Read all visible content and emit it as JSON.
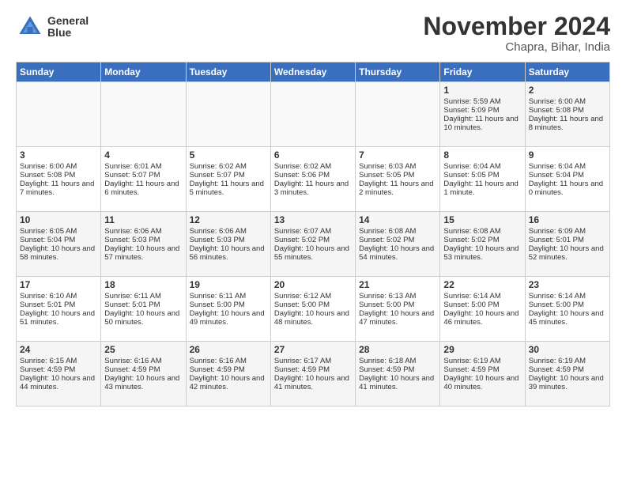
{
  "header": {
    "logo_line1": "General",
    "logo_line2": "Blue",
    "month": "November 2024",
    "location": "Chapra, Bihar, India"
  },
  "weekdays": [
    "Sunday",
    "Monday",
    "Tuesday",
    "Wednesday",
    "Thursday",
    "Friday",
    "Saturday"
  ],
  "weeks": [
    [
      {
        "day": "",
        "info": ""
      },
      {
        "day": "",
        "info": ""
      },
      {
        "day": "",
        "info": ""
      },
      {
        "day": "",
        "info": ""
      },
      {
        "day": "",
        "info": ""
      },
      {
        "day": "1",
        "info": "Sunrise: 5:59 AM\nSunset: 5:09 PM\nDaylight: 11 hours and 10 minutes."
      },
      {
        "day": "2",
        "info": "Sunrise: 6:00 AM\nSunset: 5:08 PM\nDaylight: 11 hours and 8 minutes."
      }
    ],
    [
      {
        "day": "3",
        "info": "Sunrise: 6:00 AM\nSunset: 5:08 PM\nDaylight: 11 hours and 7 minutes."
      },
      {
        "day": "4",
        "info": "Sunrise: 6:01 AM\nSunset: 5:07 PM\nDaylight: 11 hours and 6 minutes."
      },
      {
        "day": "5",
        "info": "Sunrise: 6:02 AM\nSunset: 5:07 PM\nDaylight: 11 hours and 5 minutes."
      },
      {
        "day": "6",
        "info": "Sunrise: 6:02 AM\nSunset: 5:06 PM\nDaylight: 11 hours and 3 minutes."
      },
      {
        "day": "7",
        "info": "Sunrise: 6:03 AM\nSunset: 5:05 PM\nDaylight: 11 hours and 2 minutes."
      },
      {
        "day": "8",
        "info": "Sunrise: 6:04 AM\nSunset: 5:05 PM\nDaylight: 11 hours and 1 minute."
      },
      {
        "day": "9",
        "info": "Sunrise: 6:04 AM\nSunset: 5:04 PM\nDaylight: 11 hours and 0 minutes."
      }
    ],
    [
      {
        "day": "10",
        "info": "Sunrise: 6:05 AM\nSunset: 5:04 PM\nDaylight: 10 hours and 58 minutes."
      },
      {
        "day": "11",
        "info": "Sunrise: 6:06 AM\nSunset: 5:03 PM\nDaylight: 10 hours and 57 minutes."
      },
      {
        "day": "12",
        "info": "Sunrise: 6:06 AM\nSunset: 5:03 PM\nDaylight: 10 hours and 56 minutes."
      },
      {
        "day": "13",
        "info": "Sunrise: 6:07 AM\nSunset: 5:02 PM\nDaylight: 10 hours and 55 minutes."
      },
      {
        "day": "14",
        "info": "Sunrise: 6:08 AM\nSunset: 5:02 PM\nDaylight: 10 hours and 54 minutes."
      },
      {
        "day": "15",
        "info": "Sunrise: 6:08 AM\nSunset: 5:02 PM\nDaylight: 10 hours and 53 minutes."
      },
      {
        "day": "16",
        "info": "Sunrise: 6:09 AM\nSunset: 5:01 PM\nDaylight: 10 hours and 52 minutes."
      }
    ],
    [
      {
        "day": "17",
        "info": "Sunrise: 6:10 AM\nSunset: 5:01 PM\nDaylight: 10 hours and 51 minutes."
      },
      {
        "day": "18",
        "info": "Sunrise: 6:11 AM\nSunset: 5:01 PM\nDaylight: 10 hours and 50 minutes."
      },
      {
        "day": "19",
        "info": "Sunrise: 6:11 AM\nSunset: 5:00 PM\nDaylight: 10 hours and 49 minutes."
      },
      {
        "day": "20",
        "info": "Sunrise: 6:12 AM\nSunset: 5:00 PM\nDaylight: 10 hours and 48 minutes."
      },
      {
        "day": "21",
        "info": "Sunrise: 6:13 AM\nSunset: 5:00 PM\nDaylight: 10 hours and 47 minutes."
      },
      {
        "day": "22",
        "info": "Sunrise: 6:14 AM\nSunset: 5:00 PM\nDaylight: 10 hours and 46 minutes."
      },
      {
        "day": "23",
        "info": "Sunrise: 6:14 AM\nSunset: 5:00 PM\nDaylight: 10 hours and 45 minutes."
      }
    ],
    [
      {
        "day": "24",
        "info": "Sunrise: 6:15 AM\nSunset: 4:59 PM\nDaylight: 10 hours and 44 minutes."
      },
      {
        "day": "25",
        "info": "Sunrise: 6:16 AM\nSunset: 4:59 PM\nDaylight: 10 hours and 43 minutes."
      },
      {
        "day": "26",
        "info": "Sunrise: 6:16 AM\nSunset: 4:59 PM\nDaylight: 10 hours and 42 minutes."
      },
      {
        "day": "27",
        "info": "Sunrise: 6:17 AM\nSunset: 4:59 PM\nDaylight: 10 hours and 41 minutes."
      },
      {
        "day": "28",
        "info": "Sunrise: 6:18 AM\nSunset: 4:59 PM\nDaylight: 10 hours and 41 minutes."
      },
      {
        "day": "29",
        "info": "Sunrise: 6:19 AM\nSunset: 4:59 PM\nDaylight: 10 hours and 40 minutes."
      },
      {
        "day": "30",
        "info": "Sunrise: 6:19 AM\nSunset: 4:59 PM\nDaylight: 10 hours and 39 minutes."
      }
    ]
  ]
}
